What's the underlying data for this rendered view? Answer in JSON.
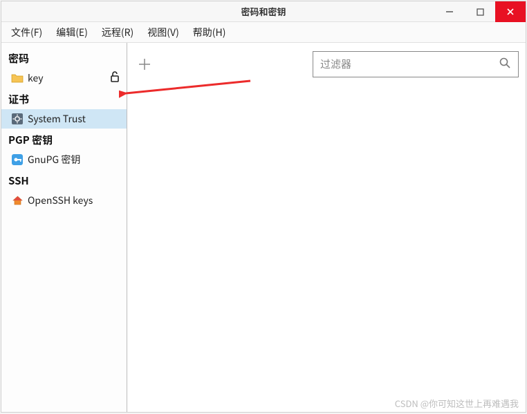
{
  "window": {
    "title": "密码和密钥"
  },
  "menu": {
    "file": "文件(F)",
    "edit": "编辑(E)",
    "remote": "远程(R)",
    "view": "视图(V)",
    "help": "帮助(H)"
  },
  "sidebar": {
    "groups": {
      "passwords": {
        "header": "密码",
        "items": {
          "key": "key"
        }
      },
      "certs": {
        "header": "证书",
        "items": {
          "system_trust": "System Trust"
        }
      },
      "pgp": {
        "header": "PGP 密钥",
        "items": {
          "gnupg": "GnuPG 密钥"
        }
      },
      "ssh": {
        "header": "SSH",
        "items": {
          "openssh": "OpenSSH keys"
        }
      }
    }
  },
  "search": {
    "placeholder": "过滤器"
  },
  "watermark": "CSDN @你可知这世上再难遇我"
}
